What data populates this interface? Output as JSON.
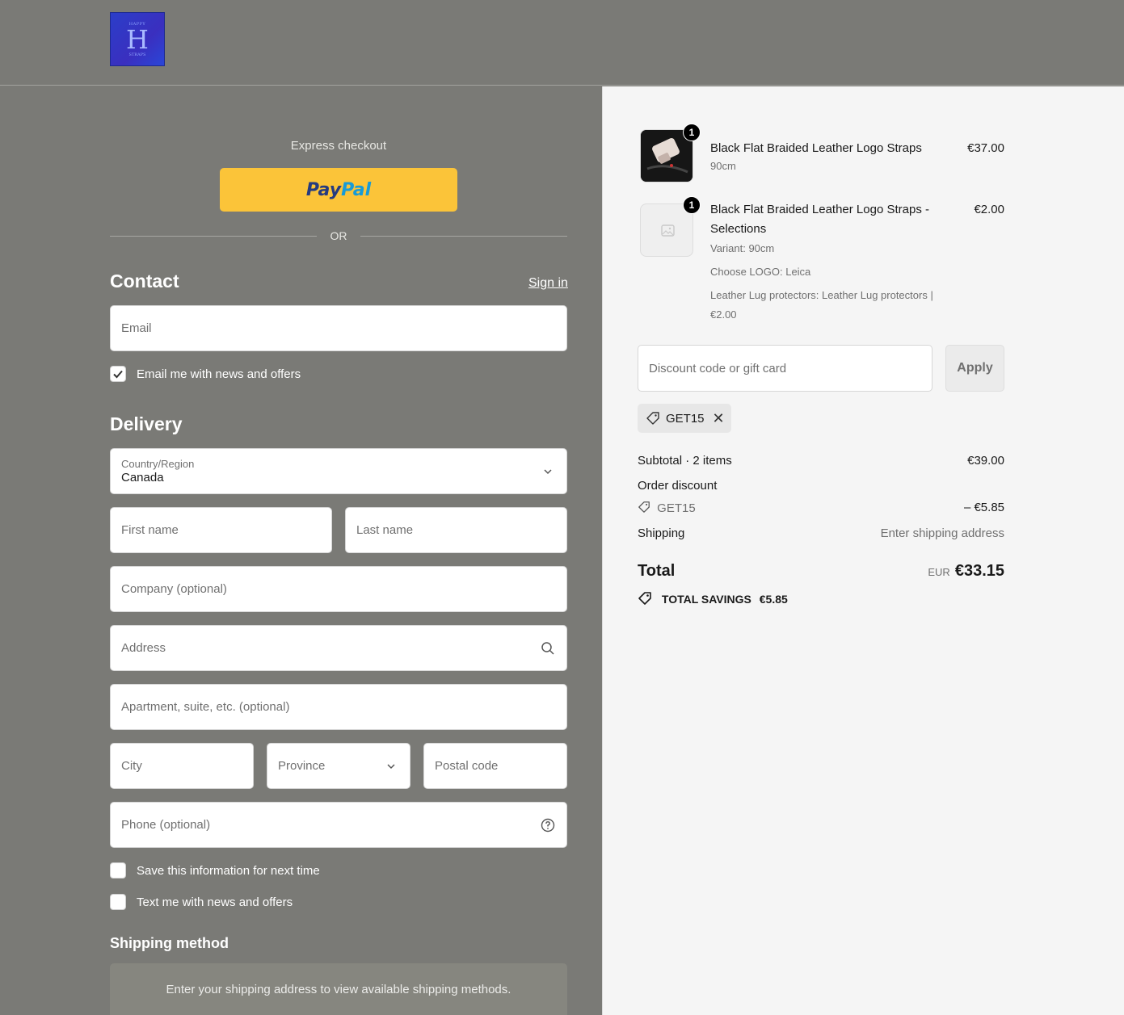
{
  "header": {
    "logo_alt": "H"
  },
  "express": {
    "label": "Express checkout",
    "paypal_pay": "Pay",
    "paypal_pal": "Pal",
    "or": "OR"
  },
  "contact": {
    "title": "Contact",
    "signin": "Sign in",
    "email_placeholder": "Email",
    "news_checkbox": "Email me with news and offers",
    "news_checked": true
  },
  "delivery": {
    "title": "Delivery",
    "country_label": "Country/Region",
    "country_value": "Canada",
    "first_name": "First name",
    "last_name": "Last name",
    "company": "Company (optional)",
    "address": "Address",
    "apartment": "Apartment, suite, etc. (optional)",
    "city": "City",
    "province": "Province",
    "postal": "Postal code",
    "phone": "Phone (optional)",
    "save_info": "Save this information for next time",
    "text_me": "Text me with news and offers"
  },
  "shipping_method": {
    "title": "Shipping method",
    "message": "Enter your shipping address to view available shipping methods."
  },
  "cart": {
    "items": [
      {
        "qty": "1",
        "title": "Black Flat Braided Leather Logo Straps",
        "sub": [
          "90cm"
        ],
        "price": "€37.00"
      },
      {
        "qty": "1",
        "title_line1": "Black Flat Braided Leather Logo Straps -",
        "title_line2": "Selections",
        "sub": [
          "Variant: 90cm",
          "Choose LOGO: Leica",
          "Leather Lug protectors: Leather Lug protectors |",
          "€2.00"
        ],
        "price": "€2.00"
      }
    ],
    "discount_placeholder": "Discount code or gift card",
    "apply": "Apply",
    "code": "GET15",
    "subtotal_label": "Subtotal · 2 items",
    "subtotal_value": "€39.00",
    "order_discount_label": "Order discount",
    "discount_code": "GET15",
    "discount_value": "– €5.85",
    "shipping_label": "Shipping",
    "shipping_value": "Enter shipping address",
    "total_label": "Total",
    "total_currency": "EUR",
    "total_value": "€33.15",
    "savings_label": "TOTAL SAVINGS",
    "savings_value": "€5.85"
  }
}
